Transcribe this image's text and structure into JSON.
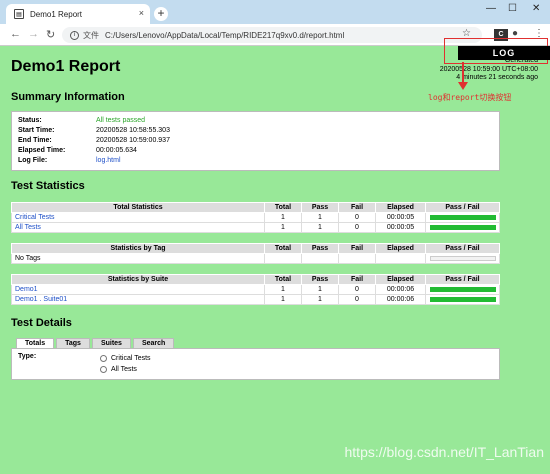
{
  "browser": {
    "tab_title": "Demo1 Report",
    "tab_close": "×",
    "new_tab": "+",
    "win_min": "—",
    "win_max": "☐",
    "win_close": "✕",
    "url_scheme": "文件",
    "url": "C:/Users/Lenovo/AppData/Local/Temp/RIDE217q9xv0.d/report.html"
  },
  "overlay": {
    "log_button": "LOG",
    "annotation": "log和report切换按钮",
    "accent": "#e03030"
  },
  "report": {
    "title": "Demo1 Report",
    "generated_label": "Generated",
    "generated_time": "20200528 10:59:00 UTC+08:00",
    "generated_ago": "4 minutes 21 seconds ago",
    "summary_heading": "Summary Information",
    "summary": [
      {
        "k": "Status:",
        "v": "All tests passed"
      },
      {
        "k": "Start Time:",
        "v": "20200528 10:58:55.303"
      },
      {
        "k": "End Time:",
        "v": "20200528 10:59:00.937"
      },
      {
        "k": "Elapsed Time:",
        "v": "00:00:05.634"
      },
      {
        "k": "Log File:",
        "v": "log.html"
      }
    ],
    "stats_heading": "Test Statistics",
    "cols": [
      "Total",
      "Pass",
      "Fail",
      "Elapsed",
      "Pass / Fail"
    ],
    "total_title": "Total Statistics",
    "total_rows": [
      {
        "name": "Critical Tests",
        "total": "1",
        "pass": "1",
        "fail": "0",
        "elapsed": "00:00:05"
      },
      {
        "name": "All Tests",
        "total": "1",
        "pass": "1",
        "fail": "0",
        "elapsed": "00:00:05"
      }
    ],
    "tag_title": "Statistics by Tag",
    "tag_empty": "No Tags",
    "suite_title": "Statistics by Suite",
    "suite_rows": [
      {
        "name": "Demo1",
        "total": "1",
        "pass": "1",
        "fail": "0",
        "elapsed": "00:00:06"
      },
      {
        "name": "Demo1 . Suite01",
        "total": "1",
        "pass": "1",
        "fail": "0",
        "elapsed": "00:00:06"
      }
    ],
    "details_heading": "Test Details",
    "detail_tabs": [
      "Totals",
      "Tags",
      "Suites",
      "Search"
    ],
    "type_label": "Type:",
    "type_options": [
      "Critical Tests",
      "All Tests"
    ]
  },
  "watermark": "https://blog.csdn.net/IT_LanTian"
}
